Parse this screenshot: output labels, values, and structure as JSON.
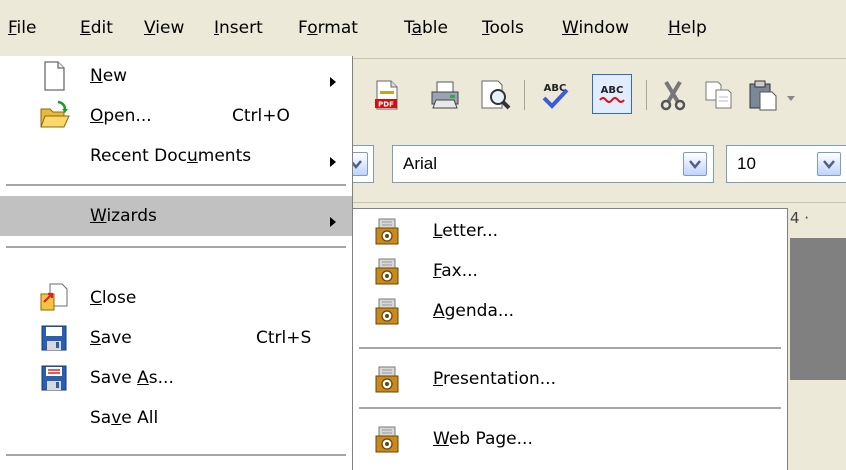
{
  "menubar": {
    "items": [
      {
        "label": "File",
        "underline": "F"
      },
      {
        "label": "Edit",
        "underline": "E"
      },
      {
        "label": "View",
        "underline": "V"
      },
      {
        "label": "Insert",
        "underline": "I"
      },
      {
        "label": "Format",
        "underline": "o"
      },
      {
        "label": "Table",
        "underline": "a"
      },
      {
        "label": "Tools",
        "underline": "T"
      },
      {
        "label": "Window",
        "underline": "W"
      },
      {
        "label": "Help",
        "underline": "H"
      }
    ]
  },
  "file_menu": {
    "items": [
      {
        "label": "New",
        "underline": "N",
        "shortcut": "",
        "submenu": true,
        "icon": "new-document-icon"
      },
      {
        "label": "Open...",
        "underline": "O",
        "shortcut": "Ctrl+O",
        "submenu": false,
        "icon": "open-folder-icon"
      },
      {
        "label": "Recent Documents",
        "underline": "u",
        "shortcut": "",
        "submenu": true,
        "icon": ""
      },
      {
        "label": "Wizards",
        "underline": "W",
        "shortcut": "",
        "submenu": true,
        "icon": "",
        "highlighted": true
      },
      {
        "label": "Close",
        "underline": "C",
        "shortcut": "",
        "submenu": false,
        "icon": "close-document-icon"
      },
      {
        "label": "Save",
        "underline": "S",
        "shortcut": "Ctrl+S",
        "submenu": false,
        "icon": "save-icon"
      },
      {
        "label": "Save As...",
        "underline": "A",
        "shortcut": "",
        "submenu": false,
        "icon": "save-as-icon"
      },
      {
        "label": "Save All",
        "underline": "v",
        "shortcut": "",
        "submenu": false,
        "icon": ""
      }
    ]
  },
  "wizards_submenu": {
    "items": [
      {
        "label": "Letter...",
        "underline": "L",
        "icon": "wizard-icon"
      },
      {
        "label": "Fax...",
        "underline": "F",
        "icon": "wizard-icon"
      },
      {
        "label": "Agenda...",
        "underline": "A",
        "icon": "wizard-icon"
      },
      {
        "label": "Presentation...",
        "underline": "P",
        "icon": "wizard-icon"
      },
      {
        "label": "Web Page...",
        "underline": "W",
        "icon": "wizard-icon"
      }
    ]
  },
  "formatting_toolbar": {
    "font_name": "Arial",
    "font_size": "10"
  },
  "ruler": {
    "visible_text": "4 ·"
  },
  "colors": {
    "menu_highlight": "#c1c1c1",
    "menubar_bg": "#ece9d8",
    "menu_bg": "#ffffff",
    "separator": "#a6a6a6"
  }
}
